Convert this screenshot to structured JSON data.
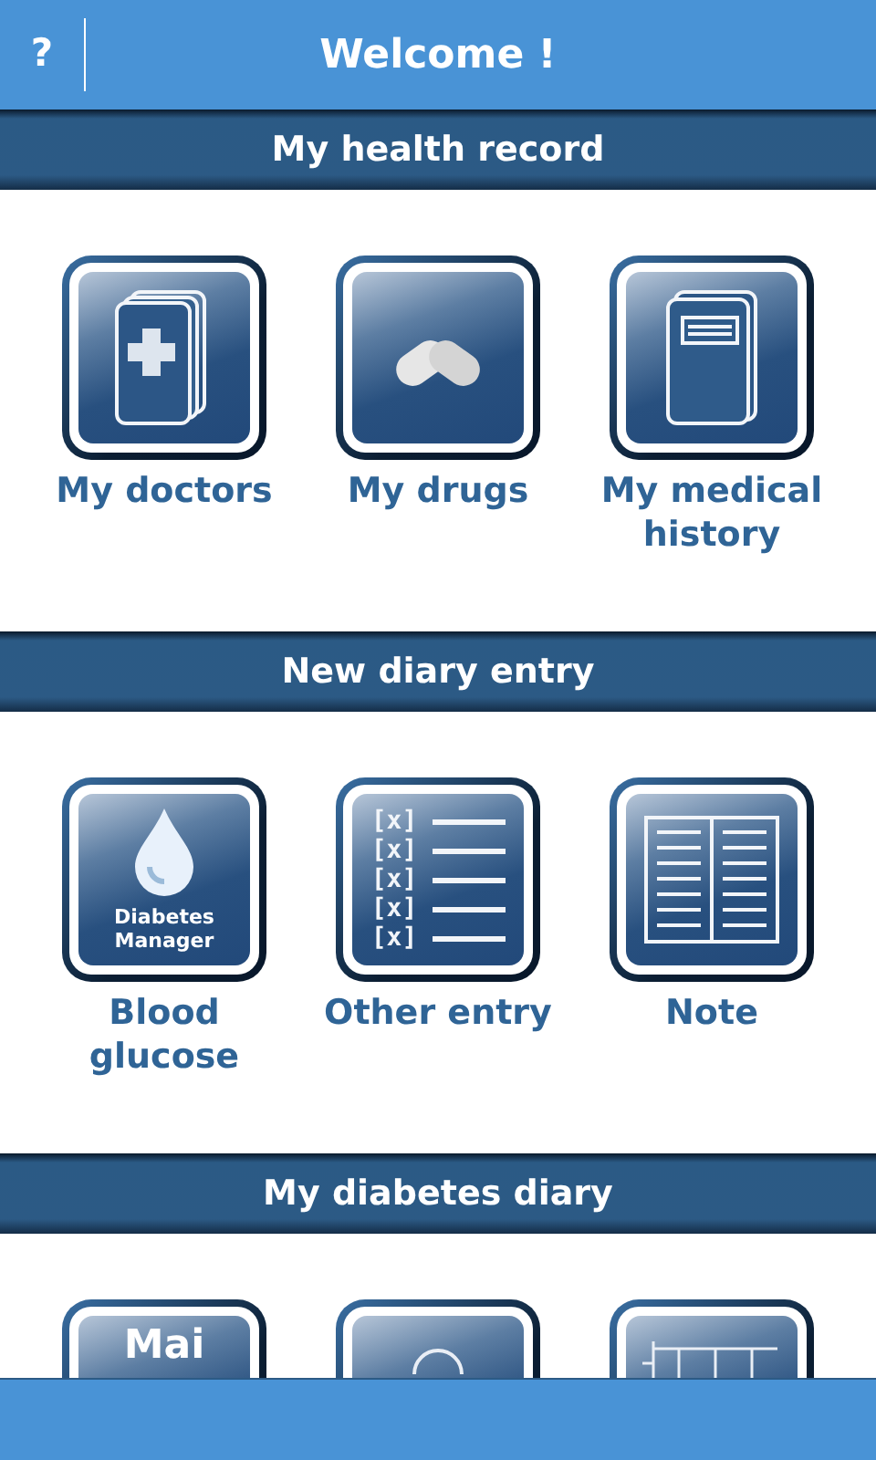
{
  "header": {
    "help_button": "?",
    "title": "Welcome !"
  },
  "sections": [
    {
      "title": "My health record",
      "items": [
        {
          "kind": "card",
          "label": "My doctors"
        },
        {
          "kind": "pills",
          "label": "My drugs"
        },
        {
          "kind": "notebook",
          "label": "My medical history"
        }
      ]
    },
    {
      "title": "New diary entry",
      "items": [
        {
          "kind": "drop",
          "icon_text": "Diabetes Manager",
          "label": "Blood glucose"
        },
        {
          "kind": "checklist",
          "icon_marks": [
            "[x]",
            "[x]",
            "[x]",
            "[x]",
            "[x]"
          ],
          "label": "Other entry"
        },
        {
          "kind": "book",
          "label": "Note"
        }
      ]
    },
    {
      "title": "My diabetes diary",
      "items": [
        {
          "kind": "month",
          "icon_text": "Mai"
        },
        {
          "kind": "arc"
        },
        {
          "kind": "grid"
        }
      ]
    }
  ]
}
